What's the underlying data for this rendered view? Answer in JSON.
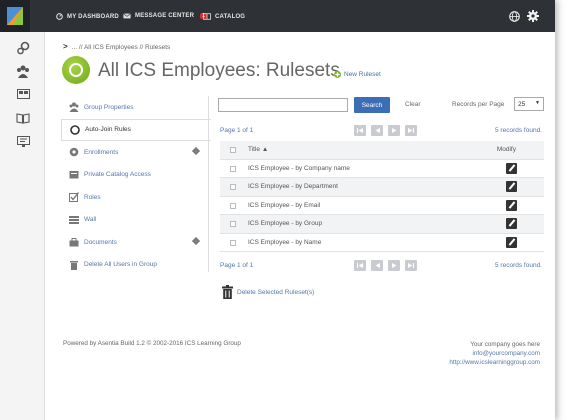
{
  "topbar": {
    "dashboard": "MY DASHBOARD",
    "messages": "MESSAGE CENTER",
    "message_count": "1",
    "catalog": "CATALOG"
  },
  "breadcrumb": {
    "prefix": ">",
    "text": "... // All ICS Employees // Rulesets"
  },
  "page": {
    "title": "All ICS Employees: Rulesets",
    "new_ruleset": "New Ruleset"
  },
  "sidenav": [
    {
      "label": "Group Properties",
      "icon": "group-icon"
    },
    {
      "label": "Auto-Join Rules",
      "icon": "auto-join-icon"
    },
    {
      "label": "Enrollments",
      "icon": "enrollments-icon"
    },
    {
      "label": "Private Catalog Access",
      "icon": "catalog-icon"
    },
    {
      "label": "Roles",
      "icon": "roles-icon"
    },
    {
      "label": "Wall",
      "icon": "wall-icon"
    },
    {
      "label": "Documents",
      "icon": "documents-icon"
    },
    {
      "label": "Delete All Users in Group",
      "icon": "trash-icon"
    }
  ],
  "search": {
    "value": "",
    "button": "Search",
    "clear": "Clear",
    "rpp_label": "Records per Page",
    "rpp_value": "25"
  },
  "pager": {
    "page": "Page 1 of 1",
    "found": "5 records found."
  },
  "grid": {
    "col_title": "Title ▲",
    "col_modify": "Modify",
    "rows": [
      "ICS Employee - by Company name",
      "ICS Employee - by Department",
      "ICS Employee - by Email",
      "ICS Employee - by Group",
      "ICS Employee - by Name"
    ]
  },
  "delete_selected": "Delete Selected Ruleset(s)",
  "footer": {
    "powered": "Powered by Asentia Build 1.2 © 2002-2016 ICS Learning Group",
    "company": "Your company goes here",
    "email": "info@yourcompany.com",
    "url": "http://www.icslearninggroup.com"
  },
  "colors": {
    "topbar": "#2e3236",
    "accent_blue": "#3b6eb4",
    "link": "#5577aa",
    "title_icon": "#7fb32a"
  }
}
